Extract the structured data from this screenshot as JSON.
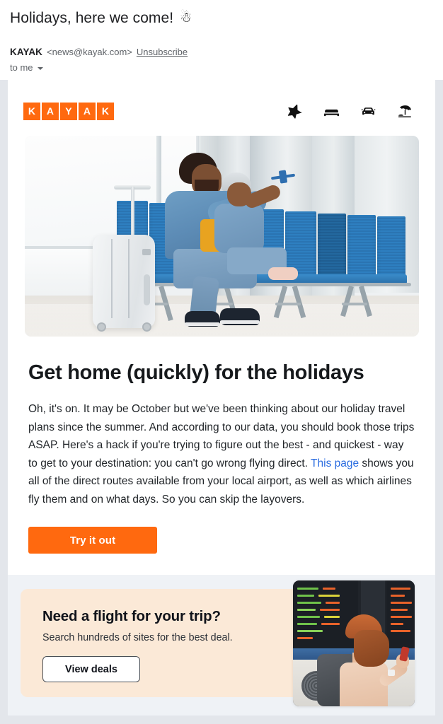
{
  "mail": {
    "subject": "Holidays, here we come!",
    "subject_emoji": "☃",
    "sender_name": "KAYAK",
    "sender_email": "<news@kayak.com>",
    "unsubscribe_label": "Unsubscribe",
    "recipient": "to me",
    "recipient_caret": "caret-down-icon"
  },
  "brand": {
    "logo_letters": [
      "K",
      "A",
      "Y",
      "A",
      "K"
    ],
    "accent_color": "#ff690f",
    "nav_icons": [
      {
        "name": "airplane-icon",
        "label": "Flights"
      },
      {
        "name": "bed-icon",
        "label": "Stays"
      },
      {
        "name": "car-icon",
        "label": "Cars"
      },
      {
        "name": "beach-umbrella-icon",
        "label": "Packages"
      }
    ]
  },
  "hero": {
    "alt": "Father and young child sitting on blue airport terminal seats with a white hardshell suitcase, child holding a toy airplane"
  },
  "article": {
    "headline": "Get home (quickly) for the holidays",
    "paragraph_part1": "Oh, it's on. It may be October but we've been thinking about our holiday travel plans since the summer. And according to our data, you should book those trips ASAP. Here's a hack if you're trying to figure out the best - and quickest - way to get to your destination: you can't go wrong flying direct. ",
    "link_text": "This page",
    "link_color": "#2a6ce0",
    "paragraph_part2": " shows you all of the direct routes available from your local airport, as well as which airlines fly them and on what days. So you can skip the layovers.",
    "cta_label": "Try it out",
    "cta_color": "#ff690f"
  },
  "promo": {
    "title": "Need a flight for your trip?",
    "subtitle": "Search hundreds of sites for the best deal.",
    "button_label": "View deals",
    "card_color": "#fbe9d7",
    "band_color": "#eff2f6",
    "photo_alt": "Traveler with backpack and hat looking at airport departure boards while holding a phone"
  }
}
